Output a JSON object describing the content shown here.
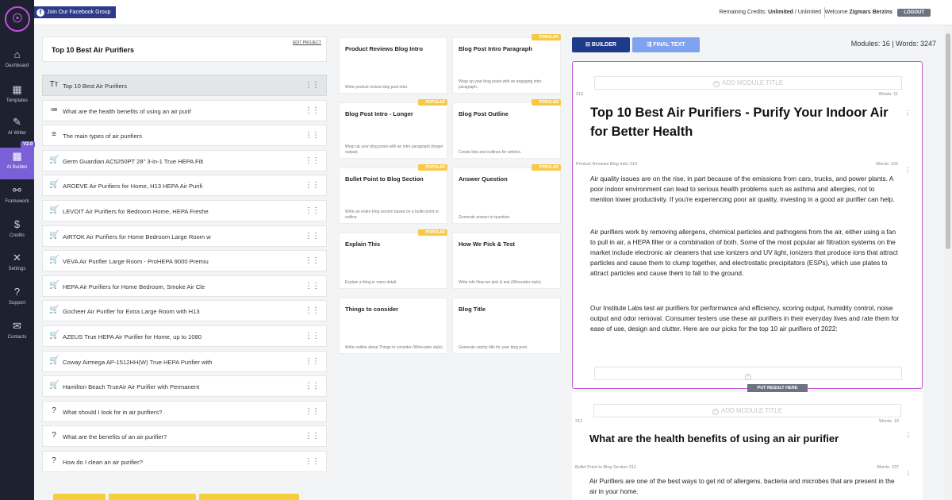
{
  "nav": {
    "logo_icon": "brain-head-logo",
    "version_badge": "V2.0",
    "items": [
      {
        "label": "Dashboard",
        "icon": "home-icon",
        "glyph": "⌂"
      },
      {
        "label": "Templates",
        "icon": "templates-icon",
        "glyph": "▦"
      },
      {
        "label": "AI Writer",
        "icon": "ai-writer-icon",
        "glyph": "✎"
      },
      {
        "label": "AI Builder",
        "icon": "ai-builder-icon",
        "glyph": "▩"
      },
      {
        "label": "Framework",
        "icon": "framework-icon",
        "glyph": "⚯"
      },
      {
        "label": "Credits",
        "icon": "credits-icon",
        "glyph": "$"
      },
      {
        "label": "Settings",
        "icon": "settings-icon",
        "glyph": "✕"
      },
      {
        "label": "Support",
        "icon": "support-icon",
        "glyph": "?"
      },
      {
        "label": "Contacts",
        "icon": "contacts-icon",
        "glyph": "✉"
      }
    ]
  },
  "topbar": {
    "facebook_label": "Join Our Facebook Group",
    "credits_prefix": "Remaining Credits:",
    "credits_value": "Unlimited",
    "credits_sep": "/",
    "credits_total": "Unlimited",
    "welcome_prefix": "Welcome",
    "welcome_name": "Zigmars Berzins",
    "logout_label": "LOGOUT"
  },
  "outline": {
    "title": "Top 10 Best Air Purifiers",
    "edit_label": "EDIT PROJECT",
    "rows": [
      {
        "icon": "Tт",
        "text": "Top 10 Best Air Purifiers",
        "selected": true
      },
      {
        "icon": "≔",
        "text": "What are the health benefits of using an air purif"
      },
      {
        "icon": "≡",
        "text": "The main types of air purifiers"
      },
      {
        "icon": "🛒",
        "text": "Germ Guardian AC5250PT 28\" 3-in-1 True HEPA Filt"
      },
      {
        "icon": "🛒",
        "text": "AROEVE Air Purifiers for Home, H13 HEPA Air Purifi"
      },
      {
        "icon": "🛒",
        "text": "LEVOIT Air Purifiers for Bedroom Home, HEPA Freshe"
      },
      {
        "icon": "🛒",
        "text": "AIRTOK Air Purifiers for Home Bedroom Large Room w"
      },
      {
        "icon": "🛒",
        "text": "VEVA Air Purifier Large Room - ProHEPA 9000 Premiu"
      },
      {
        "icon": "🛒",
        "text": "HEPA Air Purifiers for Home Bedroom, Smoke Air Cle"
      },
      {
        "icon": "🛒",
        "text": "Gocheer Air Purifier for Extra Large Room with H13"
      },
      {
        "icon": "🛒",
        "text": "AZEUS True HEPA Air Purifier for Home, up to 1080"
      },
      {
        "icon": "🛒",
        "text": "Coway Airmega AP-1512HH(W) True HEPA Purifier with"
      },
      {
        "icon": "🛒",
        "text": "Hamilton Beach TrueAir Air Purifier with Permanent"
      },
      {
        "icon": "?",
        "text": "What should I look for in air purifiers?"
      },
      {
        "icon": "?",
        "text": "What are the benefits of an air purifier?"
      },
      {
        "icon": "?",
        "text": "How do I clean an air purifier?"
      }
    ]
  },
  "modules": {
    "popular_label": "⚡POPULAR",
    "cards": [
      {
        "title": "Product Reviews Blog Intro",
        "desc": "Write product review blog post intro.",
        "popular": false
      },
      {
        "title": "Blog Post Intro Paragraph",
        "desc": "Wrap up your blog posts with an engaging intro paragraph.",
        "popular": true
      },
      {
        "title": "Blog Post Intro - Longer",
        "desc": "Wrap up your blog posts with an intro paragraph (longer output).",
        "popular": true
      },
      {
        "title": "Blog Post Outline",
        "desc": "Create lists and outlines for articles.",
        "popular": true
      },
      {
        "title": "Bullet Point to Blog Section",
        "desc": "Write an entire blog section based on a bullet point or outline",
        "popular": true
      },
      {
        "title": "Answer Question",
        "desc": "Generate answer to question.",
        "popular": true
      },
      {
        "title": "Explain This",
        "desc": "Explain a thing in more detail.",
        "popular": true
      },
      {
        "title": "How We Pick & Test",
        "desc": "Write info How we pick & test (Wirecutter style)",
        "popular": false
      },
      {
        "title": "Things to consider",
        "desc": "Write outline about Things to consider (Wirecutter style)",
        "popular": false
      },
      {
        "title": "Blog Title",
        "desc": "Generate catchy title for your blog post.",
        "popular": false
      }
    ]
  },
  "editor": {
    "builder_label": "BUILDER",
    "final_label": "FINAL TEXT",
    "stats": "Modules: 16 | Words: 3247",
    "add_module_title": "ADD MODULE TITLE",
    "put_result": "PUT RESULT HERE",
    "block1": {
      "num": "210",
      "words": "Words: 11",
      "title": "Top 10 Best Air Purifiers - Purify Your Indoor Air for Better Health"
    },
    "block2": {
      "label": "Product Reviews Blog Intro 210",
      "words": "Words: 103",
      "paragraphs": [
        "Air quality issues are on the rise, in part because of the emissions from cars, trucks, and power plants. A poor indoor environment can lead to serious health problems such as asthma and allergies, not to mention lower productivity. If you're experiencing poor air quality, investing in a good air purifier can help.",
        "Air purifiers work by removing allergens, chemical particles and pathogens from the air, either using a fan to pull in air, a HEPA filter or a combination of both. Some of the most popular air filtration systems on the market include electronic air cleaners that use ionizers and UV light, ionizers that produce ions that attract particles and cause them to clump together, and electrostatic precipitators (ESPs), which use plates to attract particles and cause them to fall to the ground.",
        "Our Institute Labs test air purifiers for performance and efficiency, scoring output, humidity control, noise output and odor removal. Consumer testers use these air purifiers in their everyday lives and rate them for ease of use, design and clutter. Here are our picks for the top 10 air purifiers of 2022:"
      ]
    },
    "block3": {
      "num": "211",
      "words": "Words: 10",
      "title": "What are the health benefits of using an air purifier"
    },
    "block4": {
      "label": "Bullet Point to Blog Section 211",
      "words": "Words: 137",
      "paragraph": "Air Purifiers are one of the best ways to get rid of allergens, bacteria and microbes that are present in the air in your home."
    }
  }
}
